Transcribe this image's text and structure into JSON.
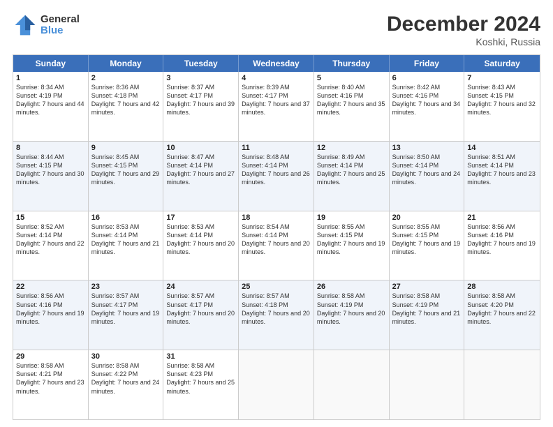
{
  "logo": {
    "general": "General",
    "blue": "Blue"
  },
  "header": {
    "title": "December 2024",
    "subtitle": "Koshki, Russia"
  },
  "days": [
    "Sunday",
    "Monday",
    "Tuesday",
    "Wednesday",
    "Thursday",
    "Friday",
    "Saturday"
  ],
  "weeks": [
    [
      {
        "day": "1",
        "sunrise": "Sunrise: 8:34 AM",
        "sunset": "Sunset: 4:19 PM",
        "daylight": "Daylight: 7 hours and 44 minutes."
      },
      {
        "day": "2",
        "sunrise": "Sunrise: 8:36 AM",
        "sunset": "Sunset: 4:18 PM",
        "daylight": "Daylight: 7 hours and 42 minutes."
      },
      {
        "day": "3",
        "sunrise": "Sunrise: 8:37 AM",
        "sunset": "Sunset: 4:17 PM",
        "daylight": "Daylight: 7 hours and 39 minutes."
      },
      {
        "day": "4",
        "sunrise": "Sunrise: 8:39 AM",
        "sunset": "Sunset: 4:17 PM",
        "daylight": "Daylight: 7 hours and 37 minutes."
      },
      {
        "day": "5",
        "sunrise": "Sunrise: 8:40 AM",
        "sunset": "Sunset: 4:16 PM",
        "daylight": "Daylight: 7 hours and 35 minutes."
      },
      {
        "day": "6",
        "sunrise": "Sunrise: 8:42 AM",
        "sunset": "Sunset: 4:16 PM",
        "daylight": "Daylight: 7 hours and 34 minutes."
      },
      {
        "day": "7",
        "sunrise": "Sunrise: 8:43 AM",
        "sunset": "Sunset: 4:15 PM",
        "daylight": "Daylight: 7 hours and 32 minutes."
      }
    ],
    [
      {
        "day": "8",
        "sunrise": "Sunrise: 8:44 AM",
        "sunset": "Sunset: 4:15 PM",
        "daylight": "Daylight: 7 hours and 30 minutes."
      },
      {
        "day": "9",
        "sunrise": "Sunrise: 8:45 AM",
        "sunset": "Sunset: 4:15 PM",
        "daylight": "Daylight: 7 hours and 29 minutes."
      },
      {
        "day": "10",
        "sunrise": "Sunrise: 8:47 AM",
        "sunset": "Sunset: 4:14 PM",
        "daylight": "Daylight: 7 hours and 27 minutes."
      },
      {
        "day": "11",
        "sunrise": "Sunrise: 8:48 AM",
        "sunset": "Sunset: 4:14 PM",
        "daylight": "Daylight: 7 hours and 26 minutes."
      },
      {
        "day": "12",
        "sunrise": "Sunrise: 8:49 AM",
        "sunset": "Sunset: 4:14 PM",
        "daylight": "Daylight: 7 hours and 25 minutes."
      },
      {
        "day": "13",
        "sunrise": "Sunrise: 8:50 AM",
        "sunset": "Sunset: 4:14 PM",
        "daylight": "Daylight: 7 hours and 24 minutes."
      },
      {
        "day": "14",
        "sunrise": "Sunrise: 8:51 AM",
        "sunset": "Sunset: 4:14 PM",
        "daylight": "Daylight: 7 hours and 23 minutes."
      }
    ],
    [
      {
        "day": "15",
        "sunrise": "Sunrise: 8:52 AM",
        "sunset": "Sunset: 4:14 PM",
        "daylight": "Daylight: 7 hours and 22 minutes."
      },
      {
        "day": "16",
        "sunrise": "Sunrise: 8:53 AM",
        "sunset": "Sunset: 4:14 PM",
        "daylight": "Daylight: 7 hours and 21 minutes."
      },
      {
        "day": "17",
        "sunrise": "Sunrise: 8:53 AM",
        "sunset": "Sunset: 4:14 PM",
        "daylight": "Daylight: 7 hours and 20 minutes."
      },
      {
        "day": "18",
        "sunrise": "Sunrise: 8:54 AM",
        "sunset": "Sunset: 4:14 PM",
        "daylight": "Daylight: 7 hours and 20 minutes."
      },
      {
        "day": "19",
        "sunrise": "Sunrise: 8:55 AM",
        "sunset": "Sunset: 4:15 PM",
        "daylight": "Daylight: 7 hours and 19 minutes."
      },
      {
        "day": "20",
        "sunrise": "Sunrise: 8:55 AM",
        "sunset": "Sunset: 4:15 PM",
        "daylight": "Daylight: 7 hours and 19 minutes."
      },
      {
        "day": "21",
        "sunrise": "Sunrise: 8:56 AM",
        "sunset": "Sunset: 4:16 PM",
        "daylight": "Daylight: 7 hours and 19 minutes."
      }
    ],
    [
      {
        "day": "22",
        "sunrise": "Sunrise: 8:56 AM",
        "sunset": "Sunset: 4:16 PM",
        "daylight": "Daylight: 7 hours and 19 minutes."
      },
      {
        "day": "23",
        "sunrise": "Sunrise: 8:57 AM",
        "sunset": "Sunset: 4:17 PM",
        "daylight": "Daylight: 7 hours and 19 minutes."
      },
      {
        "day": "24",
        "sunrise": "Sunrise: 8:57 AM",
        "sunset": "Sunset: 4:17 PM",
        "daylight": "Daylight: 7 hours and 20 minutes."
      },
      {
        "day": "25",
        "sunrise": "Sunrise: 8:57 AM",
        "sunset": "Sunset: 4:18 PM",
        "daylight": "Daylight: 7 hours and 20 minutes."
      },
      {
        "day": "26",
        "sunrise": "Sunrise: 8:58 AM",
        "sunset": "Sunset: 4:19 PM",
        "daylight": "Daylight: 7 hours and 20 minutes."
      },
      {
        "day": "27",
        "sunrise": "Sunrise: 8:58 AM",
        "sunset": "Sunset: 4:19 PM",
        "daylight": "Daylight: 7 hours and 21 minutes."
      },
      {
        "day": "28",
        "sunrise": "Sunrise: 8:58 AM",
        "sunset": "Sunset: 4:20 PM",
        "daylight": "Daylight: 7 hours and 22 minutes."
      }
    ],
    [
      {
        "day": "29",
        "sunrise": "Sunrise: 8:58 AM",
        "sunset": "Sunset: 4:21 PM",
        "daylight": "Daylight: 7 hours and 23 minutes."
      },
      {
        "day": "30",
        "sunrise": "Sunrise: 8:58 AM",
        "sunset": "Sunset: 4:22 PM",
        "daylight": "Daylight: 7 hours and 24 minutes."
      },
      {
        "day": "31",
        "sunrise": "Sunrise: 8:58 AM",
        "sunset": "Sunset: 4:23 PM",
        "daylight": "Daylight: 7 hours and 25 minutes."
      },
      null,
      null,
      null,
      null
    ]
  ]
}
